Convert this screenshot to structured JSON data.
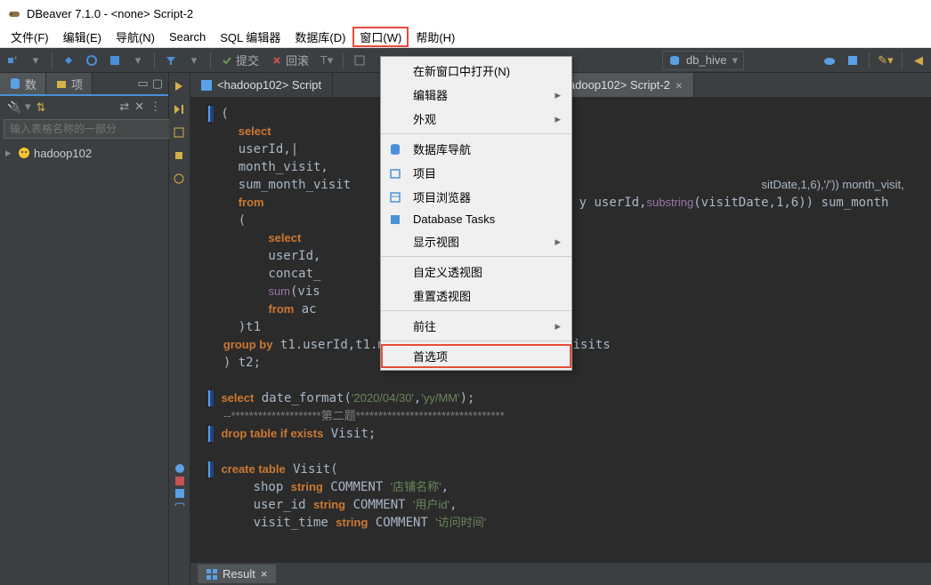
{
  "titlebar": {
    "text": "DBeaver 7.1.0 - <none> Script-2"
  },
  "menubar": {
    "file": "文件(F)",
    "edit": "编辑(E)",
    "navigate": "导航(N)",
    "search": "Search",
    "sql_editor": "SQL 编辑器",
    "database": "数据库(D)",
    "window": "窗口(W)",
    "help": "帮助(H)"
  },
  "toolbar": {
    "commit": "提交",
    "rollback": "回滚",
    "dbhive": "db_hive"
  },
  "left_panel": {
    "tab1": "数",
    "tab2": "项",
    "search_placeholder": "输入表格名称的一部分",
    "tree_item": "hadoop102"
  },
  "editor": {
    "tab1": "<hadoop102> Script",
    "tab2": "<hadoop102> Script-2",
    "code_lines": [
      "(",
      "  select",
      "  userId,|",
      "  month_visit,",
      "  sum_month_visit",
      "  from",
      "  (",
      "      select",
      "      userId,",
      "      concat_",
      "      sum(vis",
      "      from ac",
      "  )t1",
      "group by t1.userId,t1.month_visit,t1.sum_month_visits",
      ") t2;",
      "",
      "select date_format('2020/04/30','yy/MM');",
      "--********************第二题*********************************",
      "drop table if exists Visit;",
      "",
      "create table Visit(",
      "    shop string COMMENT '店铺名称',",
      "    user_id string COMMENT '用户id',",
      "    visit_time string COMMENT '访问时间'"
    ],
    "partial_right1": "sitDate,1,6),'/')) month_visit,",
    "partial_right2": "y userId,substring(visitDate,1,6)) sum_month"
  },
  "result_tab": "Result",
  "dropdown": {
    "new_window": "在新窗口中打开(N)",
    "editor": "编辑器",
    "appearance": "外观",
    "db_nav": "数据库导航",
    "project": "项目",
    "project_browser": "项目浏览器",
    "db_tasks": "Database Tasks",
    "show_view": "显示视图",
    "custom_perspective": "自定义透视图",
    "reset_perspective": "重置透视图",
    "goto": "前往",
    "preferences": "首选项"
  }
}
